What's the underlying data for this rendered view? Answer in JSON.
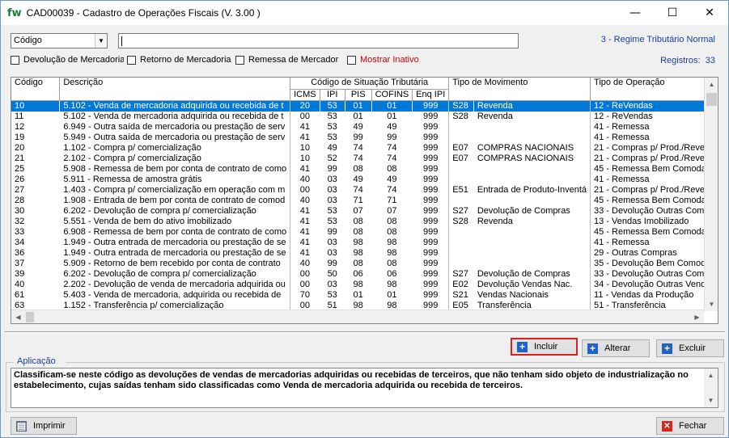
{
  "window": {
    "logo": "fw",
    "title": "CAD00039 -  Cadastro de Operações Fiscais  (V.  3.00 )",
    "minimize": "—",
    "maximize": "☐",
    "close": "✕"
  },
  "filter": {
    "field_selected": "Código",
    "search_value": "",
    "regime": "3 - Regime Tributário Normal",
    "registros_label": "Registros:",
    "registros_count": "33"
  },
  "checkboxes": [
    {
      "label": "Devolução de Mercadoria",
      "checked": false
    },
    {
      "label": "Retorno de Mercadoria",
      "checked": false
    },
    {
      "label": "Remessa de Mercador",
      "checked": false
    },
    {
      "label": "Mostrar Inativo",
      "checked": false
    }
  ],
  "table": {
    "headers": {
      "codigo": "Código",
      "descricao": "Descrição",
      "cst_group": "Código de Situação Tributária",
      "icms": "ICMS",
      "ipi": "IPI",
      "pis": "PIS",
      "cofins": "COFINS",
      "enq_ipi": "Enq IPI",
      "tipo_movimento": "Tipo de  Movimento",
      "tipo_operacao": "Tipo de Operação"
    },
    "rows": [
      [
        "10",
        "5.102 - Venda de mercadoria adquirida ou recebida de t",
        "20",
        "53",
        "01",
        "01",
        "999",
        "S28",
        "Revenda",
        "12 - ReVendas"
      ],
      [
        "11",
        "5.102 - Venda de mercadoria adquirida ou recebida de t",
        "00",
        "53",
        "01",
        "01",
        "999",
        "S28",
        "Revenda",
        "12 - ReVendas"
      ],
      [
        "12",
        "6.949 - Outra saída de mercadoria ou prestação de serv",
        "41",
        "53",
        "49",
        "49",
        "999",
        "",
        "",
        "41 - Remessa"
      ],
      [
        "19",
        "5.949 - Outra saída de mercadoria ou prestação de serv",
        "41",
        "53",
        "99",
        "99",
        "999",
        "",
        "",
        "41 - Remessa"
      ],
      [
        "20",
        "1.102 - Compra p/ comercialização",
        "10",
        "49",
        "74",
        "74",
        "999",
        "E07",
        "COMPRAS NACIONAIS",
        "21 - Compras p/ Prod./Rever"
      ],
      [
        "21",
        "2.102 - Compra p/ comercialização",
        "10",
        "52",
        "74",
        "74",
        "999",
        "E07",
        "COMPRAS NACIONAIS",
        "21 - Compras p/ Prod./Rever"
      ],
      [
        "25",
        "5.908 - Remessa de bem por conta de contrato de como",
        "41",
        "99",
        "08",
        "08",
        "999",
        "",
        "",
        "45 - Remessa Bem Comodato"
      ],
      [
        "26",
        "5.911 - Remessa de amostra grátis",
        "40",
        "03",
        "49",
        "49",
        "999",
        "",
        "",
        "41 - Remessa"
      ],
      [
        "27",
        "1.403 - Compra p/ comercialização em operação com m",
        "00",
        "03",
        "74",
        "74",
        "999",
        "E51",
        "Entrada de Produto-Inventá",
        "21 - Compras p/ Prod./Rever"
      ],
      [
        "28",
        "1.908 - Entrada de bem por conta de contrato de comod",
        "40",
        "03",
        "71",
        "71",
        "999",
        "",
        "",
        "45 - Remessa Bem Comodato"
      ],
      [
        "30",
        "6.202 - Devolução de compra p/ comercialização",
        "41",
        "53",
        "07",
        "07",
        "999",
        "S27",
        "Devolução de Compras",
        "33 - Devolução Outras Compr"
      ],
      [
        "32",
        "5.551 - Venda de bem do ativo imobilizado",
        "41",
        "53",
        "08",
        "08",
        "999",
        "S28",
        "Revenda",
        "13 - Vendas Imobilizado"
      ],
      [
        "33",
        "6.908 - Remessa de bem por conta de contrato de como",
        "41",
        "99",
        "08",
        "08",
        "999",
        "",
        "",
        "45 - Remessa Bem Comodato"
      ],
      [
        "34",
        "1.949 - Outra entrada de mercadoria ou prestação de se",
        "41",
        "03",
        "98",
        "98",
        "999",
        "",
        "",
        "41 - Remessa"
      ],
      [
        "36",
        "1.949 - Outra entrada de mercadoria ou prestação de se",
        "41",
        "03",
        "98",
        "98",
        "999",
        "",
        "",
        "29 - Outras Compras"
      ],
      [
        "37",
        "5.909 - Retorno de bem recebido por conta de contrato",
        "40",
        "99",
        "08",
        "08",
        "999",
        "",
        "",
        "35 - Devolução Bem Comoda"
      ],
      [
        "39",
        "6.202 - Devolução de compra p/ comercialização",
        "00",
        "50",
        "06",
        "06",
        "999",
        "S27",
        "Devolução de Compras",
        "33 - Devolução Outras Compr"
      ],
      [
        "40",
        "2.202 - Devolução de venda de mercadoria adquirida ou",
        "00",
        "03",
        "98",
        "98",
        "999",
        "E02",
        "Devolução Vendas Nac.",
        "34 - Devolução Outras Venda"
      ],
      [
        "61",
        "5.403 - Venda de mercadoria, adquirida ou recebida de",
        "70",
        "53",
        "01",
        "01",
        "999",
        "S21",
        "Vendas Nacionais",
        "11 - Vendas da Produção"
      ],
      [
        "63",
        "1.152 - Transferência p/ comercialização",
        "00",
        "51",
        "98",
        "98",
        "999",
        "E05",
        "Transferência",
        "51 - Transferência"
      ]
    ]
  },
  "actions": {
    "incluir": "Incluir",
    "alterar": "Alterar",
    "excluir": "Excluir"
  },
  "aplicacao": {
    "label": "Aplicação",
    "text": "Classificam-se neste código as devoluções de vendas de mercadorias adquiridas ou recebidas de terceiros, que não tenham sido objeto de industrialização no estabelecimento, cujas saídas tenham sido classificadas como Venda de mercadoria adquirida ou recebida de terceiros."
  },
  "footer": {
    "imprimir": "Imprimir",
    "fechar": "Fechar"
  },
  "colors": {
    "selection": "#0078d7",
    "link_blue": "#1a3f9c",
    "inactive_red": "#d00000",
    "highlight_border": "#e02020"
  }
}
